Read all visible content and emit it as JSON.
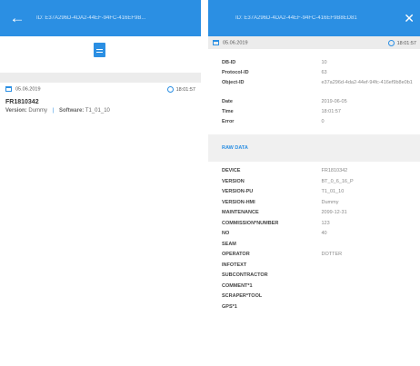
{
  "left": {
    "appbar_title": "ID: E37A296D-4DA2-44EF-94FC-416EF9B...",
    "entry": {
      "date": "05.06.2019",
      "time": "18:01:57",
      "name": "FR1810342",
      "version_label": "Version:",
      "version_value": "Dummy",
      "software_label": "Software:",
      "software_value": "T1_01_10"
    }
  },
  "right": {
    "appbar_title": "ID: E37A296D-4DA2-44EF-94FC-416EF9B8ED81",
    "date": "05.06.2019",
    "time": "18:01:57",
    "meta": [
      {
        "key": "DB-ID",
        "value": "10"
      },
      {
        "key": "Protocol-ID",
        "value": "63"
      },
      {
        "key": "Object-ID",
        "value": "e37a296d-4da2-44ef-94fc-416ef9b8e0b1"
      },
      {
        "key": "Date",
        "value": "2019-06-05"
      },
      {
        "key": "Time",
        "value": "18:01:57"
      },
      {
        "key": "Error",
        "value": "0"
      }
    ],
    "raw_title": "RAW DATA",
    "raw": [
      {
        "key": "DEVICE",
        "value": "FR1810342"
      },
      {
        "key": "VERSION",
        "value": "BT_0_6_16_P"
      },
      {
        "key": "VERSION-PU",
        "value": "T1_01_10"
      },
      {
        "key": "VERSION-HMI",
        "value": "Dummy"
      },
      {
        "key": "MAINTENANCE",
        "value": "2099-12-31"
      },
      {
        "key": "COMMISSION*NUMBER",
        "value": "123"
      },
      {
        "key": "NO",
        "value": "40"
      },
      {
        "key": "SEAM",
        "value": ""
      },
      {
        "key": "OPERATOR",
        "value": "DOTTER"
      },
      {
        "key": "INFOTEXT",
        "value": ""
      },
      {
        "key": "SUBCONTRACTOR",
        "value": ""
      },
      {
        "key": "COMMENT*1",
        "value": ""
      },
      {
        "key": "SCRAPER*TOOL",
        "value": ""
      },
      {
        "key": "GPS*1",
        "value": ""
      }
    ]
  }
}
